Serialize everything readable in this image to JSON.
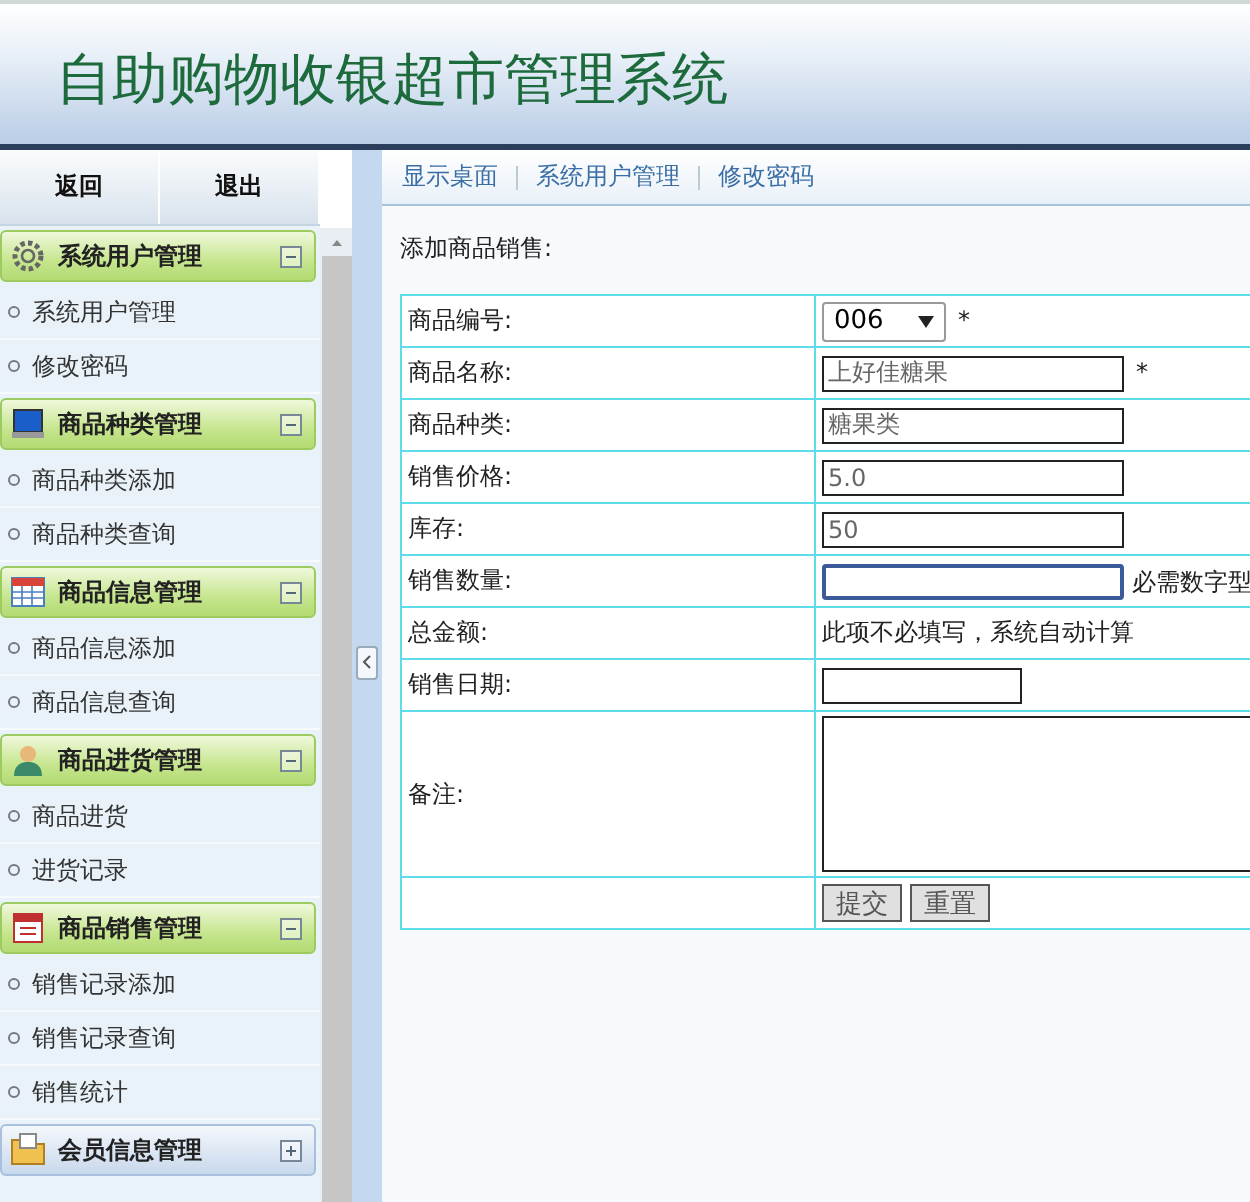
{
  "header": {
    "title": "自助购物收银超市管理系统"
  },
  "sidebar": {
    "buttons": [
      "返回",
      "退出"
    ],
    "sections": [
      {
        "title": "系统用户管理",
        "expanded": true,
        "items": [
          "系统用户管理",
          "修改密码"
        ]
      },
      {
        "title": "商品种类管理",
        "expanded": true,
        "items": [
          "商品种类添加",
          "商品种类查询"
        ]
      },
      {
        "title": "商品信息管理",
        "expanded": true,
        "items": [
          "商品信息添加",
          "商品信息查询"
        ]
      },
      {
        "title": "商品进货管理",
        "expanded": true,
        "items": [
          "商品进货",
          "进货记录"
        ]
      },
      {
        "title": "商品销售管理",
        "expanded": true,
        "items": [
          "销售记录添加",
          "销售记录查询",
          "销售统计"
        ]
      },
      {
        "title": "会员信息管理",
        "expanded": false
      }
    ]
  },
  "breadcrumb": [
    "显示桌面",
    "系统用户管理",
    "修改密码"
  ],
  "form": {
    "title": "添加商品销售:",
    "rows": [
      {
        "label": "商品编号:",
        "kind": "select",
        "value": "006",
        "mark": "*"
      },
      {
        "label": "商品名称:",
        "kind": "input",
        "value": "上好佳糖果",
        "mark": "*",
        "focused": false
      },
      {
        "label": "商品种类:",
        "kind": "input",
        "value": "糖果类",
        "focused": false
      },
      {
        "label": "销售价格:",
        "kind": "input",
        "value": "5.0",
        "focused": false
      },
      {
        "label": "库存:",
        "kind": "input",
        "value": "50",
        "focused": false
      },
      {
        "label": "销售数量:",
        "kind": "input",
        "focused": true,
        "hint": "必需数字型"
      },
      {
        "label": "总金额:",
        "kind": "note",
        "note": "此项不必填写，系统自动计算"
      },
      {
        "label": "销售日期:",
        "kind": "date"
      },
      {
        "label": "备注:",
        "kind": "textarea"
      },
      {
        "kind": "buttons",
        "buttons": [
          "提交",
          "重置"
        ]
      }
    ]
  }
}
